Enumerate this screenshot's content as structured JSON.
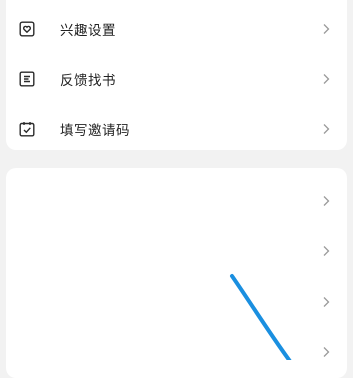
{
  "menu_top": {
    "items": [
      {
        "label": "兴趣设置",
        "icon": "heart-box-icon"
      },
      {
        "label": "反馈找书",
        "icon": "list-doc-icon"
      },
      {
        "label": "填写邀请码",
        "icon": "check-clipboard-icon"
      }
    ]
  },
  "menu_bottom": {
    "item_count": 4
  },
  "colors": {
    "accent_icon": "#e8474b",
    "text": "#222222",
    "chevron": "#9a9a9a",
    "annotation_line": "#1a8fe0"
  }
}
